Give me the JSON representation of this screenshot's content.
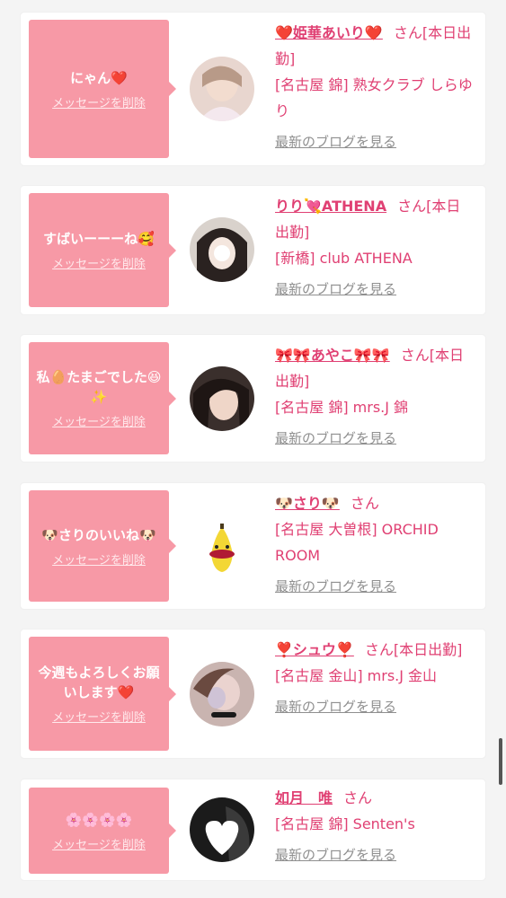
{
  "messages": [
    {
      "message": "にゃん❤️",
      "delete_label": "メッセージを削除",
      "name": "❤️姫華あいり❤️",
      "suffix": "さん[本日出勤]",
      "shop": "[名古屋 錦] 熟女クラブ しらゆり",
      "blog_label": "最新のブログを見る"
    },
    {
      "message": "すばいーーーね🥰",
      "delete_label": "メッセージを削除",
      "name": "りり💘ATHENA",
      "suffix": "さん[本日出勤]",
      "shop": "[新橋] club ATHENA",
      "blog_label": "最新のブログを見る"
    },
    {
      "message": "私🥚たまごでした😆✨",
      "delete_label": "メッセージを削除",
      "name": "🎀🎀あやこ🎀🎀",
      "suffix": "さん[本日出勤]",
      "shop": "[名古屋 錦] mrs.J 錦",
      "blog_label": "最新のブログを見る"
    },
    {
      "message": "🐶さりのいいね🐶",
      "delete_label": "メッセージを削除",
      "name": "🐶さり🐶",
      "suffix": "さん",
      "shop": "[名古屋 大曽根] ORCHID ROOM",
      "blog_label": "最新のブログを見る"
    },
    {
      "message": "今週もよろしくお願いします❤️",
      "delete_label": "メッセージを削除",
      "name": "❣️シュウ❣️",
      "suffix": "さん[本日出勤]",
      "shop": "[名古屋 金山] mrs.J 金山",
      "blog_label": "最新のブログを見る"
    },
    {
      "message": "🌸🌸🌸🌸",
      "delete_label": "メッセージを削除",
      "name": "如月　唯",
      "suffix": "さん",
      "shop": "[名古屋 錦] Senten's",
      "blog_label": "最新のブログを見る"
    }
  ],
  "colors": {
    "bubble": "#f799a6",
    "accent": "#e04073",
    "link_gray": "#8f8f8f",
    "background": "#f4f4f4"
  },
  "icons": [
    "avatar-photo",
    "banana-character",
    "dark-hair-portrait"
  ]
}
